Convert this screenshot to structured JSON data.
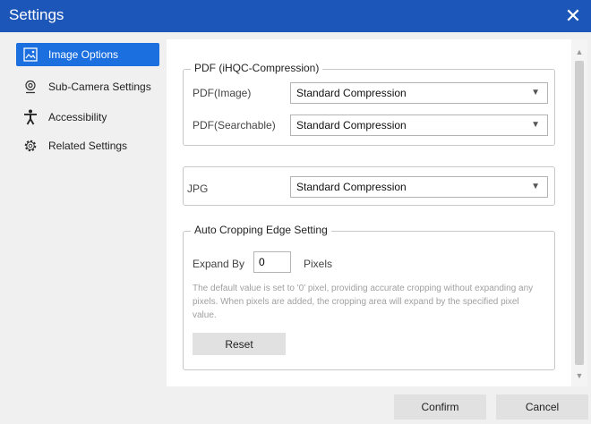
{
  "window": {
    "title": "Settings"
  },
  "sidebar": {
    "items": [
      {
        "label": "Image Options",
        "icon": "image-options-icon",
        "active": true
      },
      {
        "label": "Sub-Camera Settings",
        "icon": "webcam-icon",
        "active": false
      },
      {
        "label": "Accessibility",
        "icon": "accessibility-icon",
        "active": false
      },
      {
        "label": "Related Settings",
        "icon": "gear-icon",
        "active": false
      }
    ]
  },
  "pdf": {
    "legend": "PDF (iHQC-Compression)",
    "image_label": "PDF(Image)",
    "image_value": "Standard Compression",
    "searchable_label": "PDF(Searchable)",
    "searchable_value": "Standard Compression"
  },
  "jpg": {
    "label": "JPG",
    "value": "Standard Compression"
  },
  "cropping": {
    "legend": "Auto Cropping Edge Setting",
    "expand_label": "Expand By",
    "expand_value": "0",
    "unit": "Pixels",
    "help": "The default value is set to '0' pixel, providing accurate cropping without expanding any pixels. When pixels are added, the cropping area will expand by the specified pixel value.",
    "reset_label": "Reset"
  },
  "footer": {
    "confirm_label": "Confirm",
    "cancel_label": "Cancel"
  },
  "colors": {
    "title_bar": "#1b56b8",
    "accent": "#1b6fde"
  }
}
